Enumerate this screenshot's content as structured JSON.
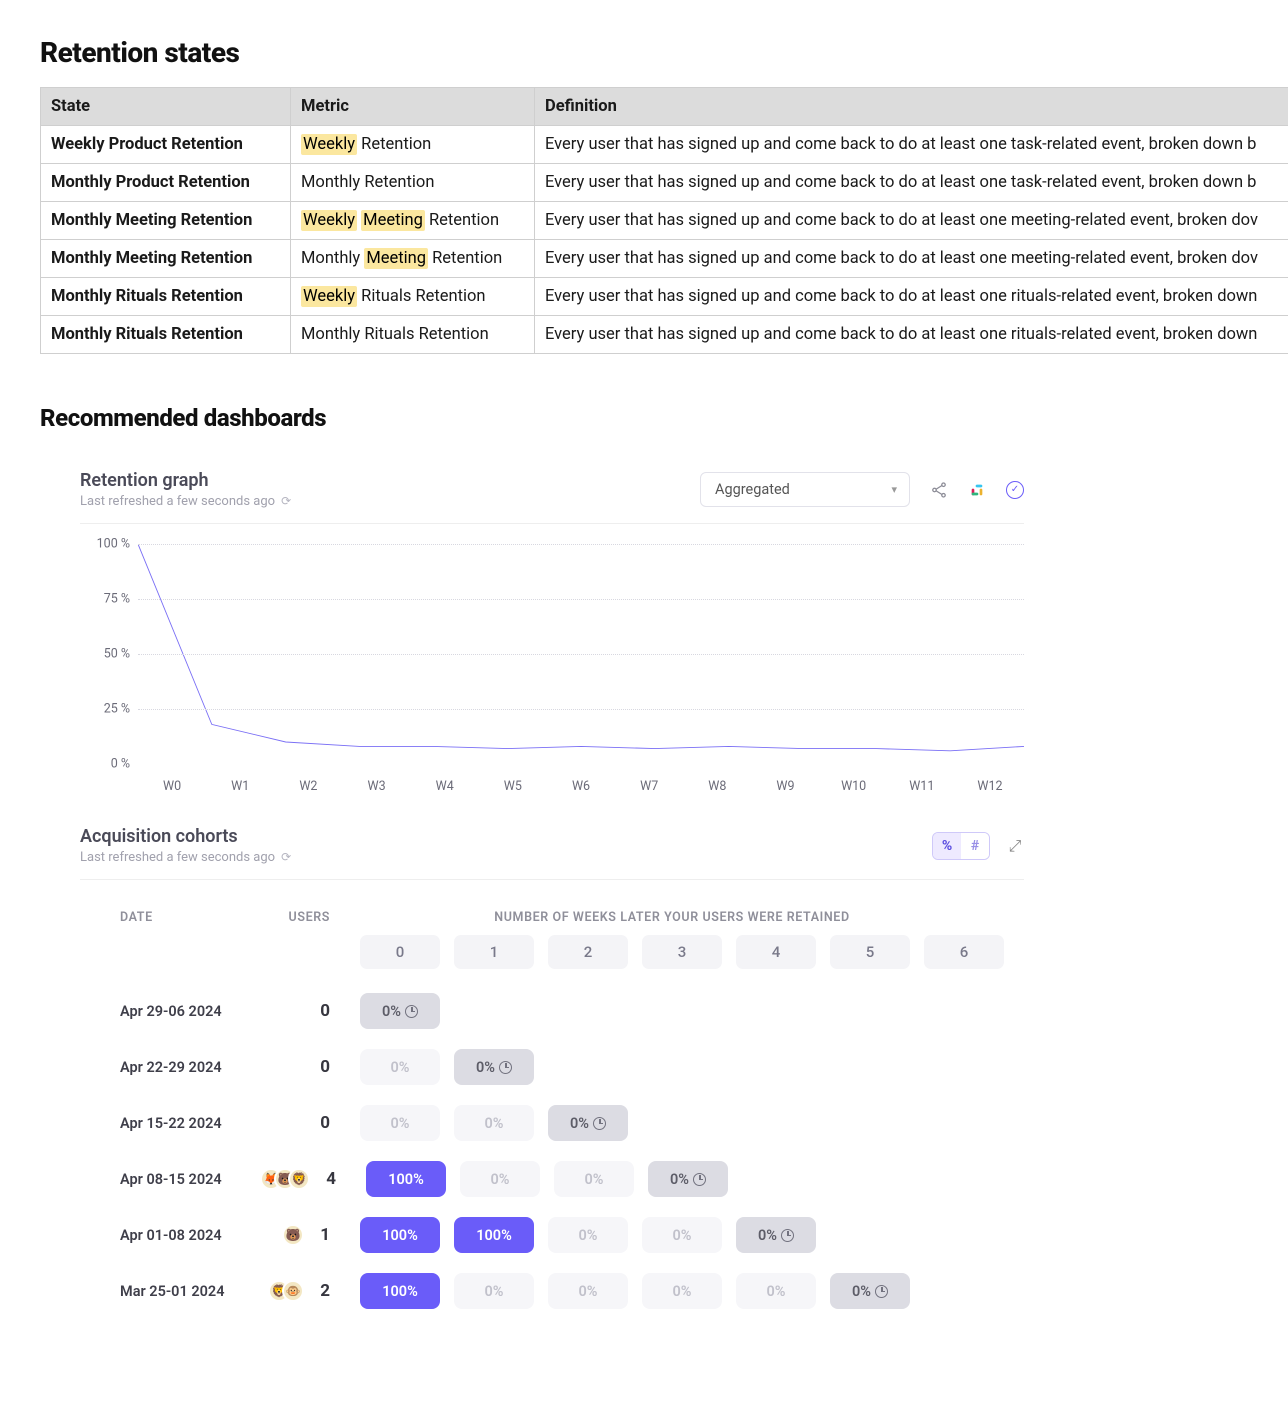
{
  "sections": {
    "retention_heading": "Retention states",
    "dashboards_heading": "Recommended dashboards"
  },
  "highlights": [
    "Weekly",
    "Meeting"
  ],
  "retention_table": {
    "columns": [
      "State",
      "Metric",
      "Definition"
    ],
    "rows": [
      {
        "state": "Weekly Product Retention",
        "metric": "Weekly Retention",
        "definition": "Every user that has signed up and come back to do at least one task-related event, broken down b"
      },
      {
        "state": "Monthly Product Retention",
        "metric": "Monthly Retention",
        "definition": "Every user that has signed up and come back to do at least one task-related event, broken down b"
      },
      {
        "state": "Monthly Meeting Retention",
        "metric": "Weekly Meeting Retention",
        "definition": "Every user that has signed up and come back to do at least one meeting-related event, broken dov"
      },
      {
        "state": "Monthly Meeting Retention",
        "metric": "Monthly Meeting Retention",
        "definition": "Every user that has signed up and come back to do at least one meeting-related event, broken dov"
      },
      {
        "state": "Monthly Rituals Retention",
        "metric": "Weekly Rituals Retention",
        "definition": "Every user that has signed up and come back to do at least one rituals-related event, broken down"
      },
      {
        "state": "Monthly Rituals Retention",
        "metric": "Monthly Rituals Retention",
        "definition": "Every user that has signed up and come back to do at least one rituals-related event, broken down"
      }
    ]
  },
  "retention_graph": {
    "title": "Retention graph",
    "subtitle": "Last refreshed a few seconds ago",
    "selector_value": "Aggregated"
  },
  "chart_data": {
    "type": "line",
    "title": "Retention graph",
    "xlabel": "",
    "ylabel": "",
    "ylim": [
      0,
      100
    ],
    "y_ticks": [
      0,
      25,
      50,
      75,
      100
    ],
    "y_tick_labels": [
      "0 %",
      "25 %",
      "50 %",
      "75 %",
      "100 %"
    ],
    "x_tick_labels": [
      "W0",
      "W1",
      "W2",
      "W3",
      "W4",
      "W5",
      "W6",
      "W7",
      "W8",
      "W9",
      "W10",
      "W11",
      "W12"
    ],
    "series": [
      {
        "name": "Aggregated",
        "x": [
          0,
          1,
          2,
          3,
          4,
          5,
          6,
          7,
          8,
          9,
          10,
          11,
          12
        ],
        "values": [
          100,
          18,
          10,
          8,
          8,
          7,
          8,
          7,
          8,
          7,
          7,
          6,
          8
        ]
      }
    ]
  },
  "cohorts": {
    "title": "Acquisition cohorts",
    "subtitle": "Last refreshed a few seconds ago",
    "toggle_percent": "%",
    "toggle_count": "#",
    "headers": {
      "date": "DATE",
      "users": "USERS",
      "span": "NUMBER OF WEEKS LATER YOUR USERS WERE RETAINED"
    },
    "week_numbers": [
      "0",
      "1",
      "2",
      "3",
      "4",
      "5",
      "6"
    ],
    "rows": [
      {
        "date": "Apr 29-06 2024",
        "users": 0,
        "avatars": 0,
        "cells": [
          "0%c"
        ]
      },
      {
        "date": "Apr 22-29 2024",
        "users": 0,
        "avatars": 0,
        "cells": [
          "0%",
          "0%c"
        ]
      },
      {
        "date": "Apr 15-22 2024",
        "users": 0,
        "avatars": 0,
        "cells": [
          "0%",
          "0%",
          "0%c"
        ]
      },
      {
        "date": "Apr 08-15 2024",
        "users": 4,
        "avatars": 3,
        "cells": [
          "100%",
          "0%",
          "0%",
          "0%c"
        ]
      },
      {
        "date": "Apr 01-08 2024",
        "users": 1,
        "avatars": 1,
        "cells": [
          "100%",
          "100%",
          "0%",
          "0%",
          "0%c"
        ]
      },
      {
        "date": "Mar 25-01 2024",
        "users": 2,
        "avatars": 2,
        "cells": [
          "100%",
          "0%",
          "0%",
          "0%",
          "0%",
          "0%c"
        ]
      }
    ]
  }
}
